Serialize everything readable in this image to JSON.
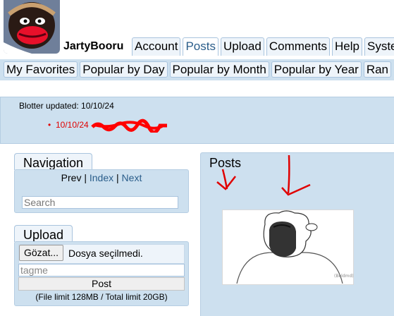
{
  "header": {
    "site_title": "JartyBooru",
    "tabs": [
      {
        "label": "Account"
      },
      {
        "label": "Posts",
        "active": true
      },
      {
        "label": "Upload"
      },
      {
        "label": "Comments"
      },
      {
        "label": "Help"
      },
      {
        "label": "Syste"
      }
    ]
  },
  "subnav": {
    "items": [
      {
        "label": "My Favorites"
      },
      {
        "label": "Popular by Day"
      },
      {
        "label": "Popular by Month"
      },
      {
        "label": "Popular by Year"
      },
      {
        "label": "Ran"
      }
    ]
  },
  "blotter": {
    "header": "Blotter updated: 10/10/24",
    "entry_date": "10/10/24"
  },
  "navigation": {
    "title": "Navigation",
    "prev": "Prev",
    "sep1": " | ",
    "index": "Index",
    "sep2": " | ",
    "next": "Next",
    "search_placeholder": "Search"
  },
  "upload": {
    "title": "Upload",
    "browse_label": "Gözat...",
    "no_file_text": "Dosya seçilmedi.",
    "tags_placeholder": "tagme",
    "post_label": "Post",
    "limit_text": "(File limit 128MB / Total limit 20GB)"
  },
  "posts": {
    "title": "Posts"
  },
  "colors": {
    "panel_bg": "#cde0ef",
    "tab_bg": "#eef4fa",
    "link": "#2a5d8a",
    "blotter_red": "#e00000"
  }
}
